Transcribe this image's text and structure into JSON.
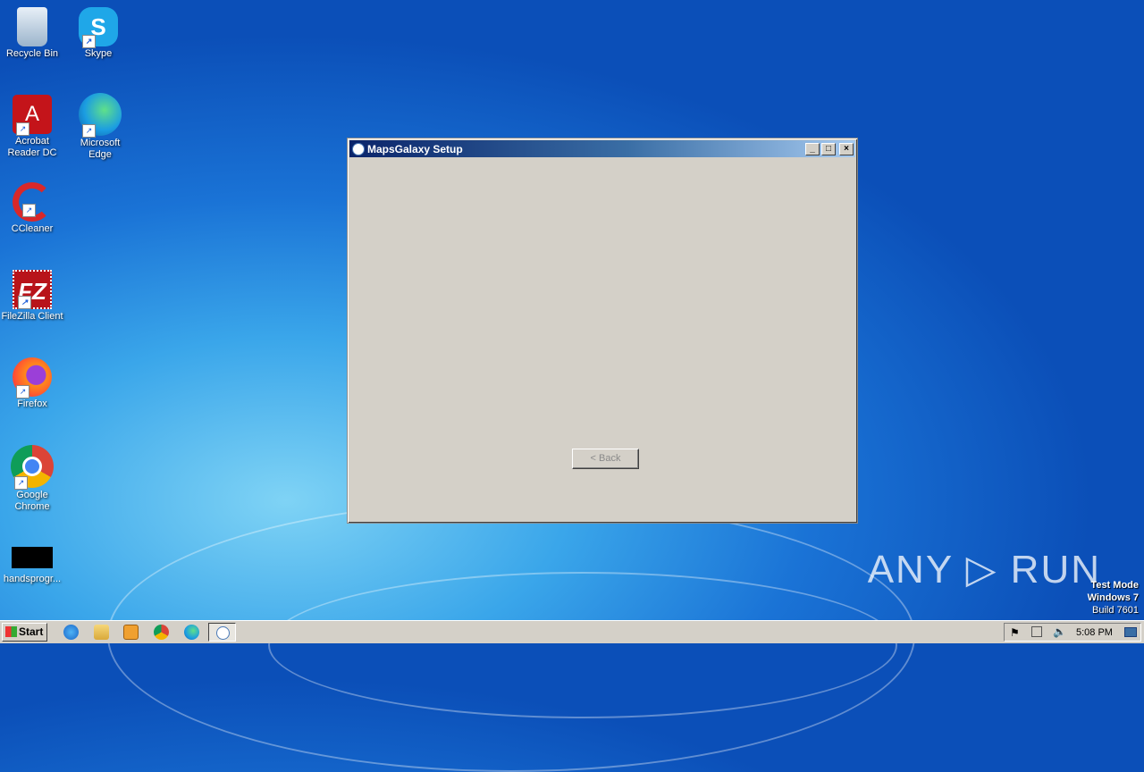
{
  "desktop": {
    "icons": [
      {
        "label": "Recycle Bin",
        "icon": "recycle-bin-icon"
      },
      {
        "label": "Skype",
        "icon": "skype-icon"
      },
      {
        "label": "Acrobat Reader DC",
        "icon": "acrobat-icon"
      },
      {
        "label": "Microsoft Edge",
        "icon": "edge-icon"
      },
      {
        "label": "CCleaner",
        "icon": "ccleaner-icon"
      },
      {
        "label": "FileZilla Client",
        "icon": "filezilla-icon"
      },
      {
        "label": "Firefox",
        "icon": "firefox-icon"
      },
      {
        "label": "Google Chrome",
        "icon": "chrome-icon"
      },
      {
        "label": "handsprogr...",
        "icon": "black-file-icon"
      }
    ]
  },
  "window": {
    "title": "MapsGalaxy Setup",
    "minimize": "_",
    "maximize": "□",
    "close": "×",
    "back_label": "< Back"
  },
  "taskbar": {
    "start_label": "Start",
    "clock": "5:08 PM"
  },
  "watermark": {
    "text": "ANY ▷ RUN"
  },
  "test_mode": {
    "line1": "Test Mode",
    "line2": "Windows 7",
    "line3": "Build 7601"
  }
}
